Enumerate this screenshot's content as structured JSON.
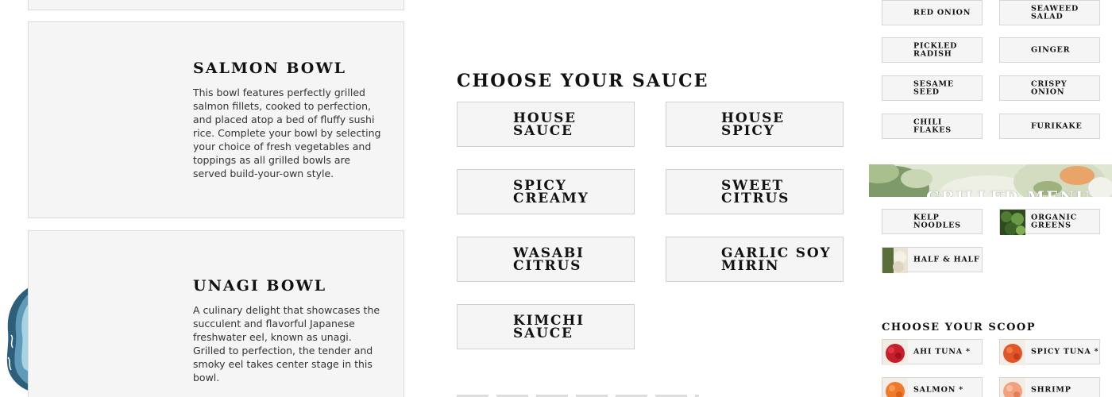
{
  "bowls": [
    {
      "title": "SALMON BOWL",
      "description": "This bowl features perfectly grilled salmon fillets, cooked to perfection, and placed atop a bed of fluffy sushi rice. Complete your bowl by selecting your choice of fresh vegetables and toppings as all grilled bowls are served build-your-own style."
    },
    {
      "title": "UNAGI BOWL",
      "description": "A culinary delight that showcases the succulent and flavorful Japanese freshwater eel, known as unagi. Grilled to perfection, the tender and smoky eel takes center stage in this bowl."
    }
  ],
  "sauce_section": {
    "heading": "CHOOSE YOUR SAUCE",
    "options": [
      {
        "label": "HOUSE SAUCE"
      },
      {
        "label": "HOUSE SPICY"
      },
      {
        "label": "SPICY\nCREAMY"
      },
      {
        "label": "SWEET CITRUS"
      },
      {
        "label": "WASABI\nCITRUS"
      },
      {
        "label": "GARLIC SOY\nMIRIN"
      },
      {
        "label": "KIMCHI SAUCE"
      }
    ]
  },
  "toppings": [
    {
      "label": "RED ONION"
    },
    {
      "label": "SEAWEED\nSALAD"
    },
    {
      "label": "PICKLED\nRADISH"
    },
    {
      "label": "GINGER"
    },
    {
      "label": "SESAME SEED"
    },
    {
      "label": "CRISPY ONION"
    },
    {
      "label": "CHILI FLAKES"
    },
    {
      "label": "FURIKAKE"
    }
  ],
  "grilled_menu": {
    "title": "GRILLED MENU",
    "bases": [
      {
        "label": "KELP\nNOODLES",
        "icon": "none"
      },
      {
        "label": "ORGANIC\nGREENS",
        "icon": "greens-thumbnail"
      },
      {
        "label": "HALF & HALF",
        "icon": "rice-greens-thumbnail"
      }
    ]
  },
  "scoop_section": {
    "heading": "CHOOSE YOUR SCOOP",
    "options": [
      {
        "label": "AHI TUNA *",
        "icon": "ahi-tuna-thumbnail"
      },
      {
        "label": "SPICY TUNA *",
        "icon": "spicy-tuna-thumbnail"
      },
      {
        "label": "SALMON *",
        "icon": "salmon-thumbnail"
      },
      {
        "label": "SHRIMP",
        "icon": "shrimp-thumbnail"
      }
    ]
  },
  "colors": {
    "card_background": "#f5f5f5",
    "card_border": "#dcdcdc",
    "heading_text": "#111111",
    "body_text": "#333333"
  }
}
